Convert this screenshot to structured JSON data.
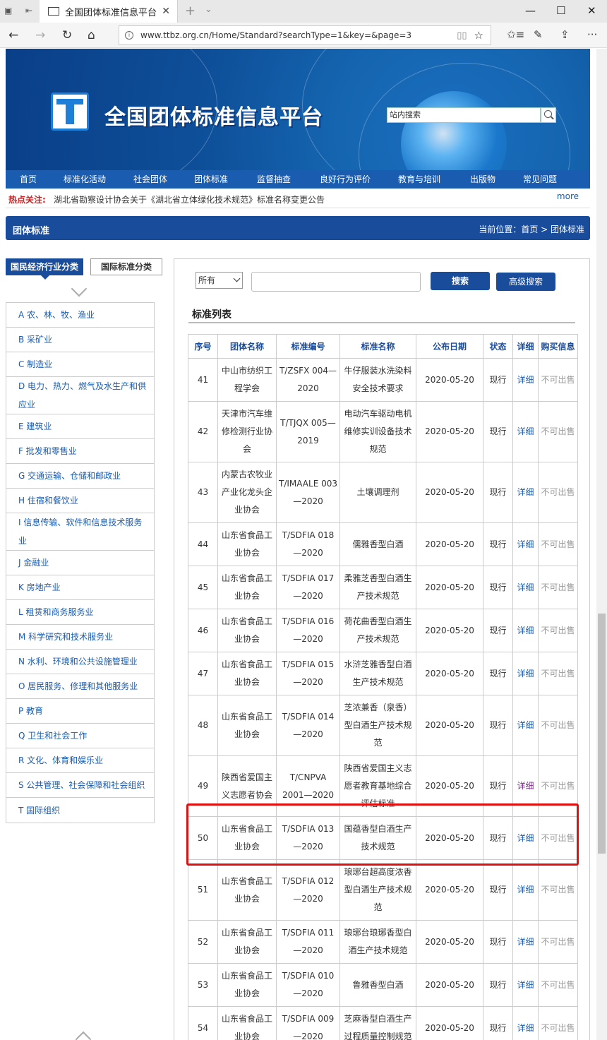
{
  "browser": {
    "tab_title": "全国团体标准信息平台",
    "url": "www.ttbz.org.cn/Home/Standard?searchType=1&key=&page=3",
    "win_min": "—",
    "win_max": "☐",
    "win_close": "✕"
  },
  "site": {
    "title": "全国团体标准信息平台",
    "search_placeholder": "站内搜索"
  },
  "nav": [
    "首页",
    "标准化活动",
    "社会团体",
    "团体标准",
    "监督抽查",
    "良好行为评价",
    "教育与培训",
    "出版物",
    "常见问题"
  ],
  "hot": {
    "label": "热点关注:",
    "text": "湖北省勘察设计协会关于《湖北省立体绿化技术规范》标准名称变更公告",
    "more": "more"
  },
  "section": {
    "title": "团体标准",
    "breadcrumb": "当前位置：首页 > 团体标准"
  },
  "sidebar": {
    "tab_active": "国民经济行业分类",
    "tab_other": "国际标准分类",
    "categories": [
      "A 农、林、牧、渔业",
      "B 采矿业",
      "C 制造业",
      "D 电力、热力、燃气及水生产和供应业",
      "E 建筑业",
      "F 批发和零售业",
      "G 交通运输、仓储和邮政业",
      "H 住宿和餐饮业",
      "I 信息传输、软件和信息技术服务业",
      "J 金融业",
      "K 房地产业",
      "L 租赁和商务服务业",
      "M 科学研究和技术服务业",
      "N 水利、环境和公共设施管理业",
      "O 居民服务、修理和其他服务业",
      "P 教育",
      "Q 卫生和社会工作",
      "R 文化、体育和娱乐业",
      "S 公共管理、社会保障和社会组织",
      "T 国际组织"
    ]
  },
  "filter": {
    "select_value": "所有",
    "search_btn": "搜索",
    "adv_btn": "高级搜索"
  },
  "list": {
    "title": "标准列表",
    "headers": [
      "序号",
      "团体名称",
      "标准编号",
      "标准名称",
      "公布日期",
      "状态",
      "详细",
      "购买信息"
    ],
    "rows": [
      [
        "41",
        "中山市纺织工程学会",
        "T/ZSFX 004—2020",
        "牛仔服装水洗染料安全技术要求",
        "2020-05-20",
        "现行",
        "详细",
        "不可出售"
      ],
      [
        "42",
        "天津市汽车维修检测行业协会",
        "T/TJQX 005—2019",
        "电动汽车驱动电机维修实训设备技术规范",
        "2020-05-20",
        "现行",
        "详细",
        "不可出售"
      ],
      [
        "43",
        "内蒙古农牧业产业化龙头企业协会",
        "T/IMAALE 003—2020",
        "土壤调理剂",
        "2020-05-20",
        "现行",
        "详细",
        "不可出售"
      ],
      [
        "44",
        "山东省食品工业协会",
        "T/SDFIA 018—2020",
        "儒雅香型白酒",
        "2020-05-20",
        "现行",
        "详细",
        "不可出售"
      ],
      [
        "45",
        "山东省食品工业协会",
        "T/SDFIA 017—2020",
        "柔雅芝香型白酒生产技术规范",
        "2020-05-20",
        "现行",
        "详细",
        "不可出售"
      ],
      [
        "46",
        "山东省食品工业协会",
        "T/SDFIA 016—2020",
        "荷花曲香型白酒生产技术规范",
        "2020-05-20",
        "现行",
        "详细",
        "不可出售"
      ],
      [
        "47",
        "山东省食品工业协会",
        "T/SDFIA 015—2020",
        "水浒芝雅香型白酒生产技术规范",
        "2020-05-20",
        "现行",
        "详细",
        "不可出售"
      ],
      [
        "48",
        "山东省食品工业协会",
        "T/SDFIA 014—2020",
        "芝浓兼香（泉香）型白酒生产技术规范",
        "2020-05-20",
        "现行",
        "详细",
        "不可出售"
      ],
      [
        "49",
        "陕西省爱国主义志愿者协会",
        "T/CNPVA 2001—2020",
        "陕西省爱国主义志愿者教育基地综合评估标准",
        "2020-05-20",
        "现行",
        "详细",
        "不可出售"
      ],
      [
        "50",
        "山东省食品工业协会",
        "T/SDFIA 013—2020",
        "国蕴香型白酒生产技术规范",
        "2020-05-20",
        "现行",
        "详细",
        "不可出售"
      ],
      [
        "51",
        "山东省食品工业协会",
        "T/SDFIA 012—2020",
        "琅琊台超高度浓香型白酒生产技术规范",
        "2020-05-20",
        "现行",
        "详细",
        "不可出售"
      ],
      [
        "52",
        "山东省食品工业协会",
        "T/SDFIA 011—2020",
        "琅琊台琅琊香型白酒生产技术规范",
        "2020-05-20",
        "现行",
        "详细",
        "不可出售"
      ],
      [
        "53",
        "山东省食品工业协会",
        "T/SDFIA 010—2020",
        "鲁雅香型白酒",
        "2020-05-20",
        "现行",
        "详细",
        "不可出售"
      ],
      [
        "54",
        "山东省食品工业协会",
        "T/SDFIA 009—2020",
        "芝麻香型白酒生产过程质量控制规范",
        "2020-05-20",
        "现行",
        "详细",
        "不可出售"
      ]
    ],
    "visited_row_index": 8
  }
}
